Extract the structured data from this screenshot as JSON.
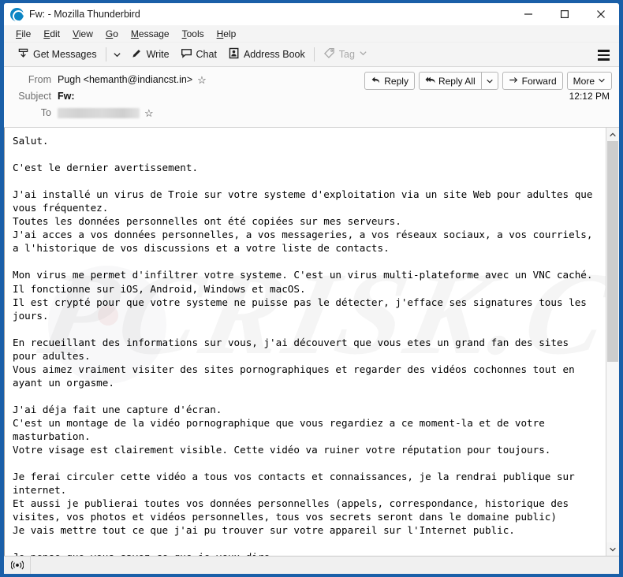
{
  "window": {
    "title": "Fw: - Mozilla Thunderbird",
    "logo_icon": "thunderbird-logo-icon",
    "minimize_icon": "minimize-icon",
    "maximize_icon": "maximize-icon",
    "close_icon": "close-icon"
  },
  "menubar": {
    "items": [
      {
        "label": "File",
        "accel": "F"
      },
      {
        "label": "Edit",
        "accel": "E"
      },
      {
        "label": "View",
        "accel": "V"
      },
      {
        "label": "Go",
        "accel": "G"
      },
      {
        "label": "Message",
        "accel": "M"
      },
      {
        "label": "Tools",
        "accel": "T"
      },
      {
        "label": "Help",
        "accel": "H"
      }
    ]
  },
  "toolbar": {
    "get_messages_label": "Get Messages",
    "write_label": "Write",
    "chat_label": "Chat",
    "address_book_label": "Address Book",
    "tag_label": "Tag",
    "hamburger_icon": "hamburger-menu-icon"
  },
  "message_header": {
    "from_label": "From",
    "from_value": "Pugh <hemanth@indiancst.in>",
    "subject_label": "Subject",
    "subject_value": "Fw:",
    "to_label": "To",
    "to_value": "",
    "timestamp": "12:12 PM",
    "star_icon": "star-outline-icon",
    "buttons": {
      "reply": "Reply",
      "reply_all": "Reply All",
      "forward": "Forward",
      "more": "More"
    }
  },
  "message_body": {
    "watermark_text": "PCRISK.COM",
    "text": "Salut.\n\nC'est le dernier avertissement.\n\nJ'ai installé un virus de Troie sur votre systeme d'exploitation via un site Web pour adultes que vous fréquentez.\nToutes les données personnelles ont été copiées sur mes serveurs.\nJ'ai acces a vos données personnelles, a vos messageries, a vos réseaux sociaux, a vos courriels, a l'historique de vos discussions et a votre liste de contacts.\n\nMon virus me permet d'infiltrer votre systeme. C'est un virus multi-plateforme avec un VNC caché.\nIl fonctionne sur iOS, Android, Windows et macOS.\nIl est crypté pour que votre systeme ne puisse pas le détecter, j'efface ses signatures tous les jours.\n\nEn recueillant des informations sur vous, j'ai découvert que vous etes un grand fan des sites pour adultes.\nVous aimez vraiment visiter des sites pornographiques et regarder des vidéos cochonnes tout en ayant un orgasme.\n\nJ'ai déja fait une capture d'écran.\nC'est un montage de la vidéo pornographique que vous regardiez a ce moment-la et de votre masturbation.\nVotre visage est clairement visible. Cette vidéo va ruiner votre réputation pour toujours.\n\nJe ferai circuler cette vidéo a tous vos contacts et connaissances, je la rendrai publique sur internet.\nEt aussi je publierai toutes vos données personnelles (appels, correspondance, historique des visites, vos photos et vidéos personnelles, tous vos secrets seront dans le domaine public)\nJe vais mettre tout ce que j'ai pu trouver sur votre appareil sur l'Internet public.\n\nJe pense que vous savez ce que je veux dire.\nCela va etre un vrai désastre pour vous."
  },
  "scrollbar": {
    "up_arrow_icon": "chevron-up-icon",
    "down_arrow_icon": "chevron-down-icon",
    "thumb_position_percent": 0,
    "thumb_size_percent": 55
  },
  "statusbar": {
    "connection_icon": "online-status-icon",
    "text": ""
  },
  "colors": {
    "window_border": "#1a5fa8",
    "toolbar_bg": "#f4f4f4",
    "header_bg": "#fbfbfb",
    "body_bg": "#ffffff",
    "accent": "#0a84c4"
  }
}
